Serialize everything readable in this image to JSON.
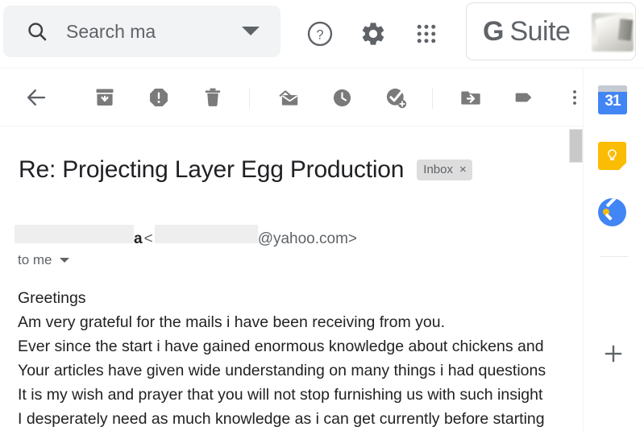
{
  "header": {
    "search": {
      "placeholder": "Search ma",
      "value": "",
      "icon": "search-icon",
      "options_icon": "chevron-down-icon"
    },
    "help_icon": "help-circle-icon",
    "settings_icon": "gear-icon",
    "apps_icon": "apps-grid-icon",
    "brand": {
      "g": "G",
      "word": "Suite",
      "avatar": "profile-avatar"
    }
  },
  "toolbar": {
    "items": [
      {
        "name": "back-button",
        "icon": "arrow-left-icon",
        "label": "Back to Inbox"
      },
      {
        "name": "archive-button",
        "icon": "archive-icon",
        "label": "Archive"
      },
      {
        "name": "report-spam-button",
        "icon": "report-spam-icon",
        "label": "Report spam"
      },
      {
        "name": "delete-button",
        "icon": "trash-icon",
        "label": "Delete"
      },
      {
        "name": "mark-unread-button",
        "icon": "mark-unread-icon",
        "label": "Mark as unread"
      },
      {
        "name": "snooze-button",
        "icon": "clock-icon",
        "label": "Snooze"
      },
      {
        "name": "add-to-tasks-button",
        "icon": "task-add-icon",
        "label": "Add to Tasks"
      },
      {
        "name": "move-to-button",
        "icon": "move-to-folder-icon",
        "label": "Move to"
      },
      {
        "name": "labels-button",
        "icon": "label-tag-icon",
        "label": "Labels"
      },
      {
        "name": "more-button",
        "icon": "more-vertical-icon",
        "label": "More"
      }
    ]
  },
  "message": {
    "subject": "Re: Projecting Layer Egg Production",
    "label_chip": {
      "text": "Inbox",
      "remove": "×"
    },
    "sender": {
      "name_redacted": true,
      "name_visible_tail": "a",
      "open_bracket": "<",
      "address_redacted": true,
      "address_visible_tail": "@yahoo.com>"
    },
    "recipient": "to me",
    "recipient_caret": "chevron-down-icon",
    "body_lines": [
      "Greetings",
      " Am very grateful for the mails i have been receiving from you.",
      "Ever since the start i have gained enormous knowledge about chickens and",
      "Your articles have given wide understanding on many things i had questions",
      "It is my wish and prayer that you will not stop furnishing us with such insight",
      "I desperately need as much knowledge as i can get currently before starting"
    ]
  },
  "side_panel": {
    "items": [
      {
        "name": "side-panel-calendar",
        "icon": "google-calendar-icon",
        "label": "Calendar",
        "badge": "31"
      },
      {
        "name": "side-panel-keep",
        "icon": "google-keep-icon",
        "label": "Keep"
      },
      {
        "name": "side-panel-tasks",
        "icon": "google-tasks-icon",
        "label": "Tasks"
      }
    ],
    "add_button": {
      "name": "side-panel-add",
      "icon": "plus-icon",
      "label": "+"
    }
  },
  "colors": {
    "calendar_blue": "#4285f4",
    "keep_yellow": "#fbbc04",
    "tasks_blue": "#4285f4",
    "chip_gray": "#ddddde",
    "search_bg": "#f1f3f4",
    "icon_gray": "#5f6368"
  }
}
